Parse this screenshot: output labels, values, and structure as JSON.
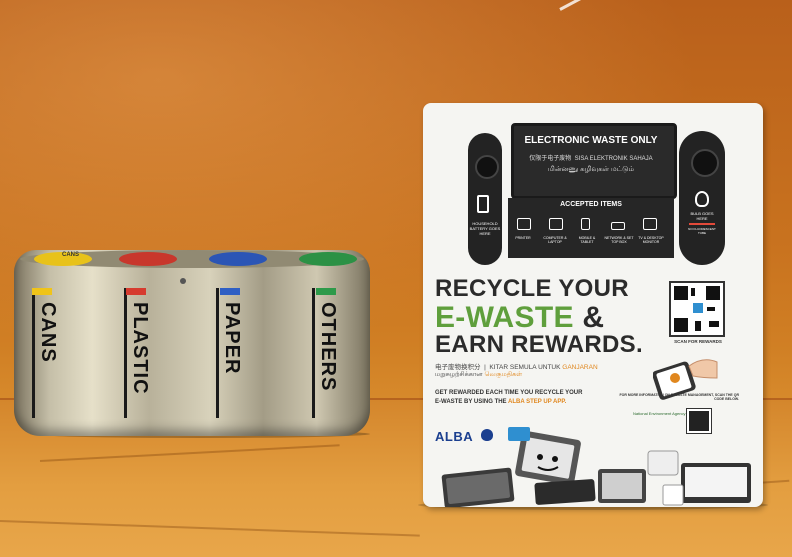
{
  "scene": "Photo of a stainless steel recycling bin and an e-waste collection sign",
  "bin": {
    "lid_text": "CANS",
    "compartments": [
      {
        "label": "CANS",
        "color": "#f0c419"
      },
      {
        "label": "PLASTIC",
        "color": "#d63b2f"
      },
      {
        "label": "PAPER",
        "color": "#2f5fc4"
      },
      {
        "label": "OTHERS",
        "color": "#2e9a4a"
      }
    ]
  },
  "sign": {
    "screen_title": "ELECTRONIC WASTE ONLY",
    "screen_sub_cn": "仅限于电子废物",
    "screen_sub_ms": "SISA ELEKTRONIK SAHAJA",
    "screen_sub_ta": "மின்னணு கழிவுகள் மட்டும்",
    "accepted_title": "ACCEPTED ITEMS",
    "accepted_items": [
      "PRINTER",
      "COMPUTER & LAPTOP",
      "MOBILE & TABLET",
      "NETWORK & SET TOP BOX",
      "TV & DESKTOP MONITOR"
    ],
    "left_pod_caption": "HOUSEHOLD BATTERY GOES HERE",
    "right_pod_caption": "BULB GOES HERE",
    "right_pod_note": "NO FLUORESCENT TUBE",
    "headline_1": "RECYCLE YOUR",
    "headline_2": "E-WASTE",
    "headline_amp": "&",
    "headline_3": "EARN REWARDS.",
    "lang_cn": "电子废物换积分",
    "lang_ms_prefix": "KITAR SEMULA UNTUK",
    "lang_ms_orange": "GANJARAN",
    "lang_ta": "மறுசுழற்சிக்கான",
    "lang_ta_orange": "வெகுமதிகள்",
    "rewards_line_1": "GET REWARDED EACH TIME YOU RECYCLE YOUR",
    "rewards_line_2a": "E-WASTE BY USING THE",
    "rewards_line_2b": "ALBA STEP UP APP.",
    "qr_caption": "SCAN FOR REWARDS",
    "more_info": "FOR MORE INFORMATION ON E-WASTE MANAGEMENT, SCAN THE QR CODE BELOW.",
    "nea": "National Environment Agency",
    "brand": "ALBA"
  }
}
